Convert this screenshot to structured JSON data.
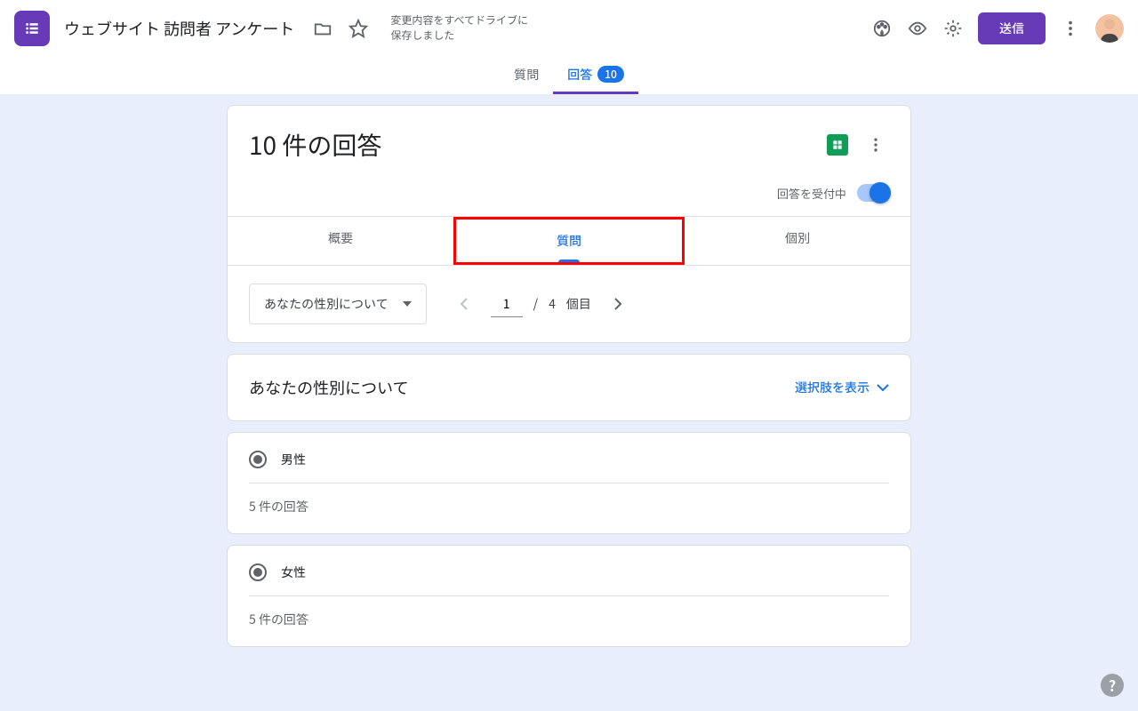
{
  "header": {
    "form_title": "ウェブサイト 訪問者 アンケート",
    "save_status_line1": "変更内容をすべてドライブに",
    "save_status_line2": "保存しました",
    "send_label": "送信"
  },
  "main_tabs": {
    "questions": "質問",
    "responses": "回答",
    "responses_badge": "10"
  },
  "responses": {
    "count_title": "10 件の回答",
    "accepting_label": "回答を受付中",
    "sub_tabs": {
      "summary": "概要",
      "question": "質問",
      "individual": "個別"
    },
    "dropdown_selected": "あなたの性別について",
    "pager": {
      "current": "1",
      "sep": "/",
      "total": "4",
      "suffix": "個目"
    }
  },
  "question": {
    "title": "あなたの性別について",
    "show_options": "選択肢を表示"
  },
  "options": [
    {
      "label": "男性",
      "count": "5 件の回答"
    },
    {
      "label": "女性",
      "count": "5 件の回答"
    }
  ],
  "help": "?"
}
